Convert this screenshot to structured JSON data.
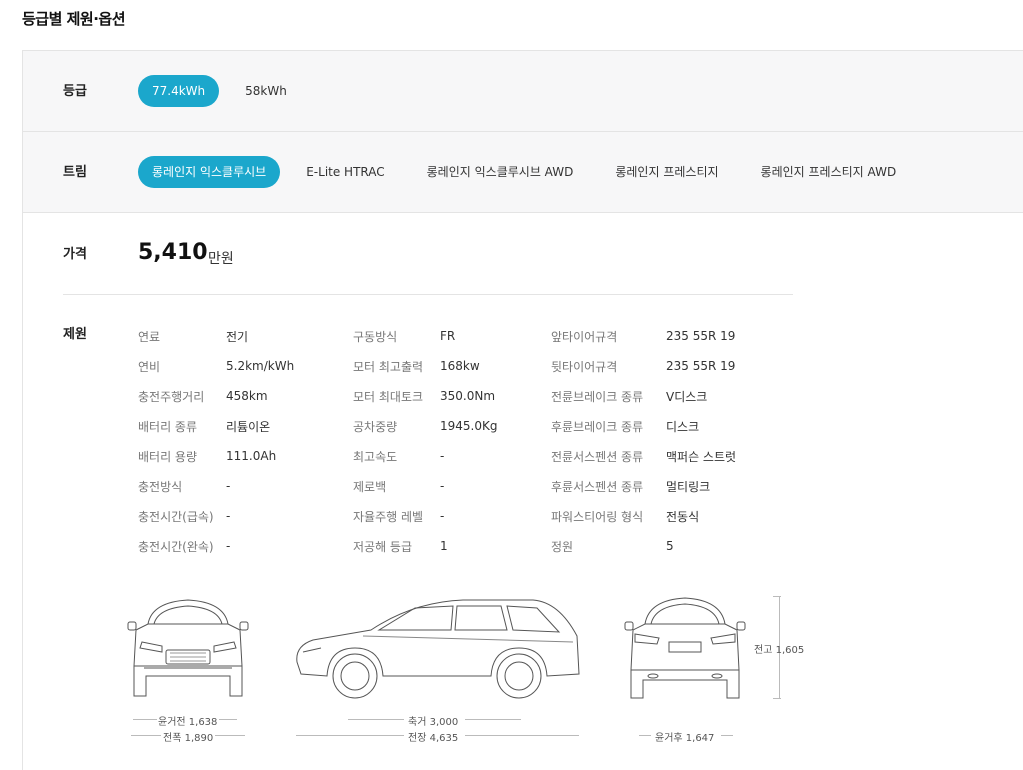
{
  "section_title": "등급별 제원·옵션",
  "grade": {
    "label": "등급",
    "options": [
      "77.4kWh",
      "58kWh"
    ],
    "selected": 0
  },
  "trim": {
    "label": "트림",
    "options": [
      "롱레인지 익스클루시브",
      "E-Lite HTRAC",
      "롱레인지 익스클루시브 AWD",
      "롱레인지 프레스티지",
      "롱레인지 프레스티지 AWD"
    ],
    "selected": 0
  },
  "price": {
    "label": "가격",
    "value": "5,410",
    "unit": "만원"
  },
  "specs": {
    "label": "제원",
    "col1": [
      {
        "key": "연료",
        "val": "전기"
      },
      {
        "key": "연비",
        "val": "5.2km/kWh"
      },
      {
        "key": "충전주행거리",
        "val": "458km"
      },
      {
        "key": "배터리 종류",
        "val": "리튬이온"
      },
      {
        "key": "배터리 용량",
        "val": "111.0Ah"
      },
      {
        "key": "충전방식",
        "val": "-"
      },
      {
        "key": "충전시간(급속)",
        "val": "-"
      },
      {
        "key": "충전시간(완속)",
        "val": "-"
      }
    ],
    "col2": [
      {
        "key": "구동방식",
        "val": "FR"
      },
      {
        "key": "모터 최고출력",
        "val": "168kw"
      },
      {
        "key": "모터 최대토크",
        "val": "350.0Nm"
      },
      {
        "key": "공차중량",
        "val": "1945.0Kg"
      },
      {
        "key": "최고속도",
        "val": "-"
      },
      {
        "key": "제로백",
        "val": "-"
      },
      {
        "key": "자율주행 레벨",
        "val": "-"
      },
      {
        "key": "저공해 등급",
        "val": "1"
      }
    ],
    "col3": [
      {
        "key": "앞타이어규격",
        "val": "235 55R 19"
      },
      {
        "key": "뒷타이어규격",
        "val": "235 55R 19"
      },
      {
        "key": "전륜브레이크 종류",
        "val": "V디스크"
      },
      {
        "key": "후륜브레이크 종류",
        "val": "디스크"
      },
      {
        "key": "전륜서스펜션 종류",
        "val": "맥퍼슨 스트럿"
      },
      {
        "key": "후륜서스펜션 종류",
        "val": "멀티링크"
      },
      {
        "key": "파워스티어링 형식",
        "val": "전동식"
      },
      {
        "key": "정원",
        "val": "5"
      }
    ]
  },
  "dimensions": {
    "front_track": "윤거전 1,638",
    "width": "전폭 1,890",
    "wheelbase": "축거 3,000",
    "length": "전장 4,635",
    "height": "전고 1,605",
    "rear_track": "윤거후 1,647"
  },
  "colors": {
    "accent": "#1ba7cc"
  }
}
